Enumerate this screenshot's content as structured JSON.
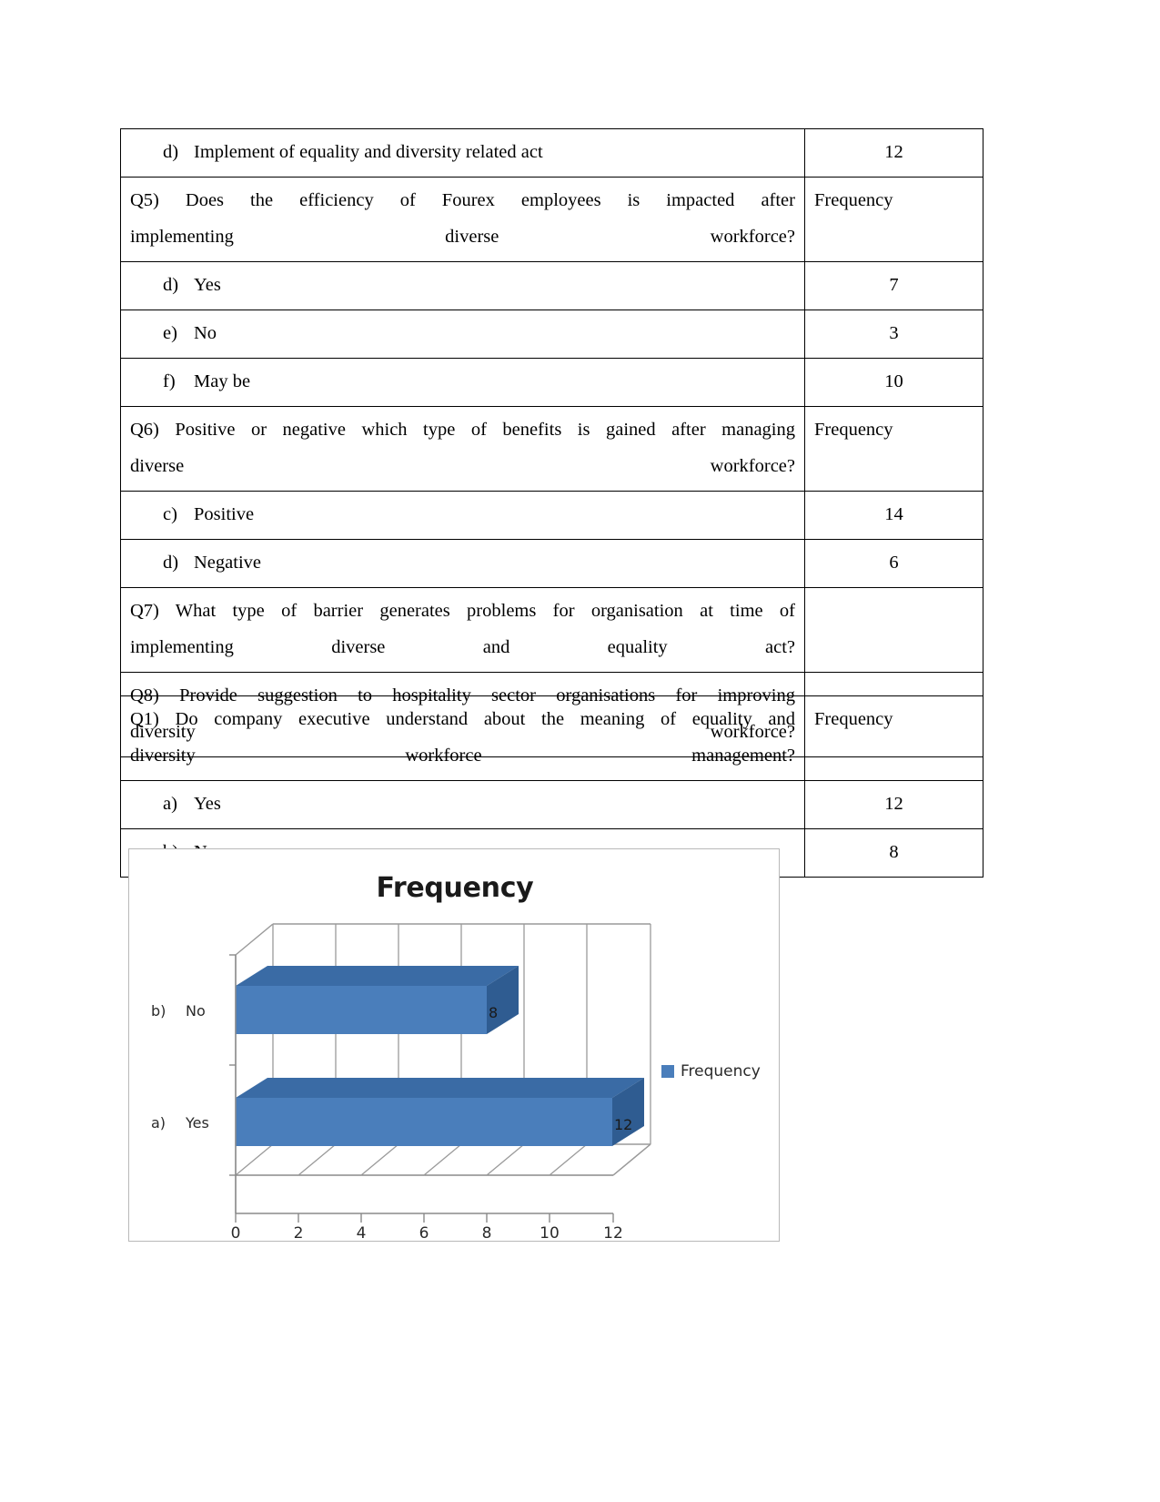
{
  "document": {
    "tables": [
      {
        "id": "questions-table",
        "rows": [
          {
            "type": "option",
            "letter": "d)",
            "text": "Implement of equality and diversity related act",
            "frequency": "12"
          },
          {
            "type": "question",
            "line1": "Q5) Does the efficiency of Fourex employees is impacted after",
            "line2": "implementing diverse workforce?",
            "frequency": "Frequency"
          },
          {
            "type": "option",
            "letter": "d)",
            "text": "Yes",
            "frequency": "7"
          },
          {
            "type": "option",
            "letter": "e)",
            "text": "No",
            "frequency": "3"
          },
          {
            "type": "option",
            "letter": "f)",
            "text": "May be",
            "frequency": "10"
          },
          {
            "type": "question",
            "line1": "Q6) Positive or negative which type of benefits is gained after managing",
            "line2": "diverse workforce?",
            "frequency": "Frequency"
          },
          {
            "type": "option",
            "letter": "c)",
            "text": "Positive",
            "frequency": "14"
          },
          {
            "type": "option",
            "letter": "d)",
            "text": "Negative",
            "frequency": "6"
          },
          {
            "type": "question",
            "line1": "Q7) What type of barrier generates problems for organisation at time of",
            "line2": "implementing diverse and equality act?",
            "frequency": ""
          },
          {
            "type": "question",
            "line1": "Q8) Provide suggestion to hospitality sector organisations for improving",
            "line2": "diversity workforce?",
            "frequency": ""
          }
        ]
      },
      {
        "id": "q1-table",
        "rows": [
          {
            "type": "question",
            "line1": "Q1) Do company executive understand about the meaning of equality and",
            "line2": "diversity workforce management?",
            "frequency": "Frequency"
          },
          {
            "type": "option",
            "letter": "a)",
            "text": "Yes",
            "frequency": "12"
          },
          {
            "type": "option",
            "letter": "b)",
            "text": "No",
            "frequency": "8"
          }
        ]
      }
    ]
  },
  "chart_data": {
    "type": "bar",
    "orientation": "horizontal",
    "style": "3d",
    "title": "Frequency",
    "xlabel": "",
    "ylabel": "",
    "categories": [
      "a)   Yes",
      "b)   No"
    ],
    "category_letters": [
      "a)",
      "b)"
    ],
    "category_names": [
      "Yes",
      "No"
    ],
    "values": [
      12,
      8
    ],
    "data_labels": [
      "12",
      "8"
    ],
    "series": [
      {
        "name": "Frequency",
        "values": [
          12,
          8
        ]
      }
    ],
    "xlim": [
      0,
      14
    ],
    "xticks": [
      0,
      2,
      4,
      6,
      8,
      10,
      12
    ],
    "xtick_labels": [
      "0",
      "2",
      "4",
      "6",
      "8",
      "10",
      "12"
    ],
    "grid": true,
    "legend": {
      "position": "right",
      "entries": [
        "Frequency"
      ]
    },
    "colors": {
      "bar_front": "#4a7ebb",
      "bar_top": "#3a6ba5",
      "bar_side": "#2f5c91",
      "grid": "#9a9a9a",
      "axis": "#808080",
      "plot_border": "#b9b9b9",
      "title": "#1a1a1a"
    }
  }
}
